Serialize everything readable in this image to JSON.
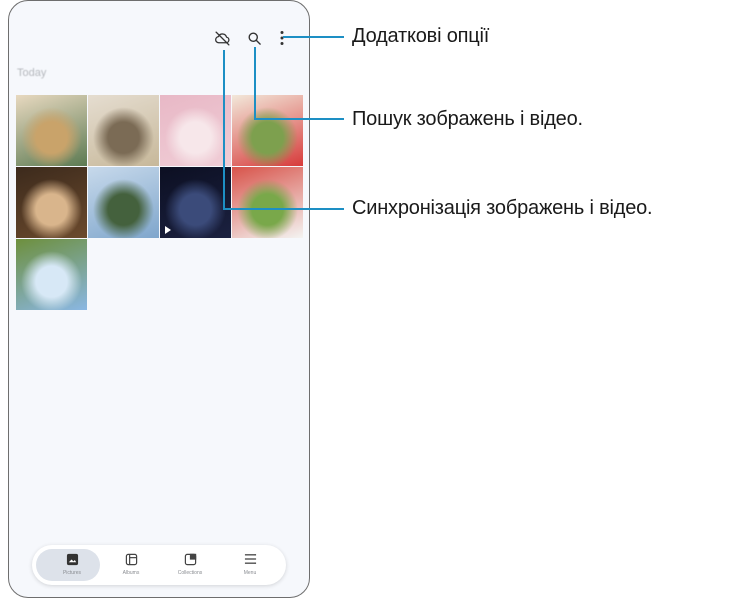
{
  "header": {
    "cloud_off_icon": "cloud-off-icon",
    "search_icon": "search-icon",
    "more_icon": "more-vertical-icon"
  },
  "section": {
    "label": "Today"
  },
  "grid": {
    "items": [
      {
        "name": "corgi-photo",
        "colors": [
          "#5c7a52",
          "#c9a36a",
          "#e8d9c0"
        ]
      },
      {
        "name": "street-village-photo",
        "colors": [
          "#c7b89a",
          "#7b6b55",
          "#e5ddd0"
        ]
      },
      {
        "name": "notebook-desk-photo",
        "colors": [
          "#f0cdd6",
          "#f7e7ea",
          "#e8b8c6"
        ]
      },
      {
        "name": "strawberry-photo",
        "colors": [
          "#d73b3b",
          "#7da04e",
          "#f2e8da"
        ]
      },
      {
        "name": "dog-cat-photo",
        "colors": [
          "#6b4a2d",
          "#d9b58c",
          "#3c2a1c"
        ]
      },
      {
        "name": "eiffel-tower-photo",
        "colors": [
          "#7fa6cc",
          "#44613d",
          "#c7d9eb"
        ]
      },
      {
        "name": "night-sky-video",
        "colors": [
          "#1b2140",
          "#3b4b7a",
          "#0c0f22"
        ]
      },
      {
        "name": "salad-photo",
        "colors": [
          "#f4f4f2",
          "#79a84a",
          "#d8534a"
        ]
      },
      {
        "name": "sky-field-photo",
        "colors": [
          "#8ab7e3",
          "#d7e8f6",
          "#6d8f3c"
        ]
      }
    ]
  },
  "nav": {
    "items": [
      {
        "label": "Pictures",
        "icon": "pictures-icon"
      },
      {
        "label": "Albums",
        "icon": "albums-icon"
      },
      {
        "label": "Collections",
        "icon": "collections-icon"
      },
      {
        "label": "Menu",
        "icon": "menu-icon"
      }
    ]
  },
  "callouts": {
    "more_options": "Додаткові опції",
    "search": "Пошук зображень і відео.",
    "sync": "Синхронізація зображень і відео."
  }
}
